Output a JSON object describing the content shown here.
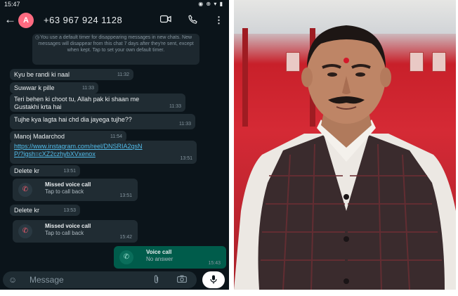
{
  "status_bar": {
    "time": "15:47",
    "app_badge": "A",
    "icons": "◉ ⊕ ▾ ▮"
  },
  "header": {
    "back_icon": "arrow-back-icon",
    "avatar_letter": "A",
    "contact": "+63 967 924 1128",
    "video_icon": "video-call-icon",
    "phone_icon": "voice-call-icon",
    "menu_icon": "more-vert-icon"
  },
  "notice": {
    "text": "You use a default timer for disappearing messages in new chats. New messages will disappear from this chat 7 days after they're sent, except when kept. Tap to set your own default timer."
  },
  "messages": [
    {
      "text": "Kyu be randi ki naal",
      "time": "11:32"
    },
    {
      "text": "Suwwar k pille",
      "time": "11:33"
    },
    {
      "text": "Teri behen ki choot tu, Allah pak ki shaan me Gustakhi krta hai",
      "time": "11:33"
    },
    {
      "text": "Tujhe kya lagta hai chd dia jayega tujhe??",
      "time": "11:33"
    },
    {
      "text": "Manoj Madarchod",
      "time": "11:54"
    },
    {
      "text": "https://www.instagram.com/reel/DNSRIA2qsNP/?igsh=cXZ2czhybXVxenox",
      "time": "13:51"
    },
    {
      "text": "Delete kr",
      "time": "13:51"
    },
    {
      "text": "Delete kr",
      "time": "13:53"
    }
  ],
  "calls": [
    {
      "title": "Missed voice call",
      "subtitle": "Tap to call back",
      "time": "13:51"
    },
    {
      "title": "Missed voice call",
      "subtitle": "Tap to call back",
      "time": "15:42"
    },
    {
      "title": "Voice call",
      "subtitle": "No answer",
      "time": "15:43"
    }
  ],
  "input": {
    "placeholder": "Message"
  },
  "colors": {
    "chat_bg": "#0b141a",
    "bubble_in": "#202c33",
    "bubble_out": "#005c4b",
    "link": "#53bdeb",
    "missed": "#f15c6d",
    "photo_bg": "#c8202a"
  }
}
